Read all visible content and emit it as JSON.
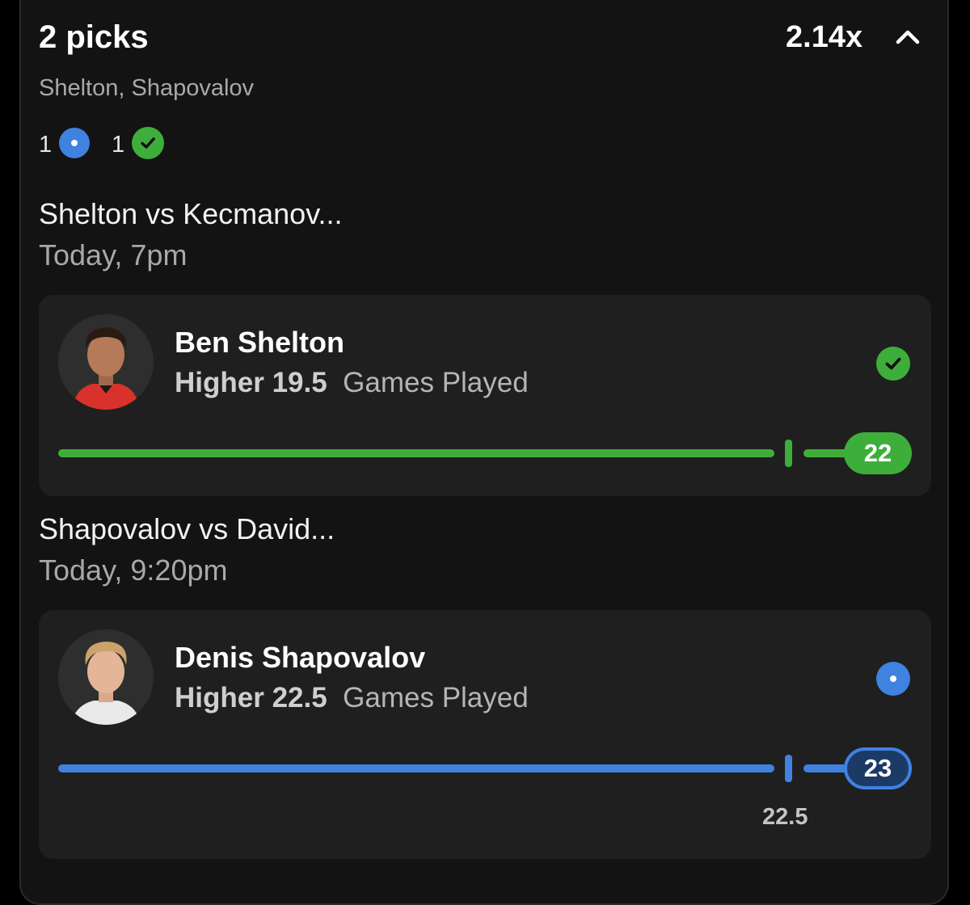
{
  "header": {
    "title": "2 picks",
    "multiplier": "2.14x",
    "players_summary": "Shelton, Shapovalov",
    "pending_count": "1",
    "won_count": "1"
  },
  "picks": [
    {
      "match": "Shelton vs Kecmanov...",
      "time": "Today, 7pm",
      "player": "Ben Shelton",
      "direction": "Higher 19.5",
      "stat": "Games Played",
      "line": 19.5,
      "result": "22",
      "status": "won",
      "line_label": ""
    },
    {
      "match": "Shapovalov vs David...",
      "time": "Today, 9:20pm",
      "player": "Denis Shapovalov",
      "direction": "Higher 22.5",
      "stat": "Games Played",
      "line": 22.5,
      "result": "23",
      "status": "pending",
      "line_label": "22.5"
    }
  ],
  "colors": {
    "won": "#3eae3a",
    "pending": "#3f82e0",
    "pill_pending_bg": "#1c3a66"
  },
  "icons": {
    "pending": "dot-icon",
    "won": "check-circle-icon",
    "collapse": "chevron-up-icon"
  }
}
